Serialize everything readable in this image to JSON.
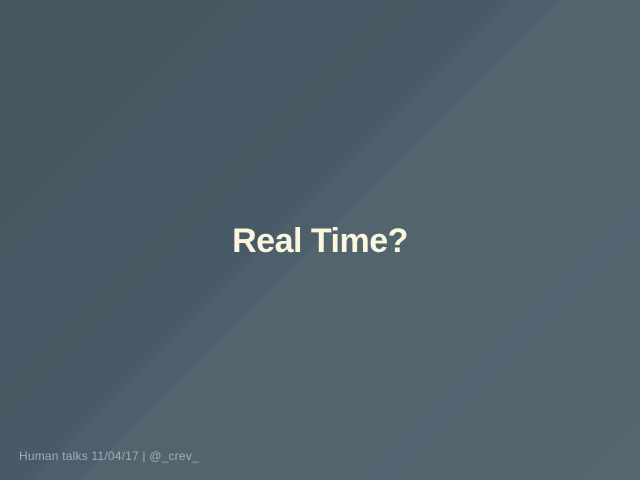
{
  "slide": {
    "title": "Real Time?",
    "footer": "Human talks 11/04/17 | @_crev_"
  }
}
